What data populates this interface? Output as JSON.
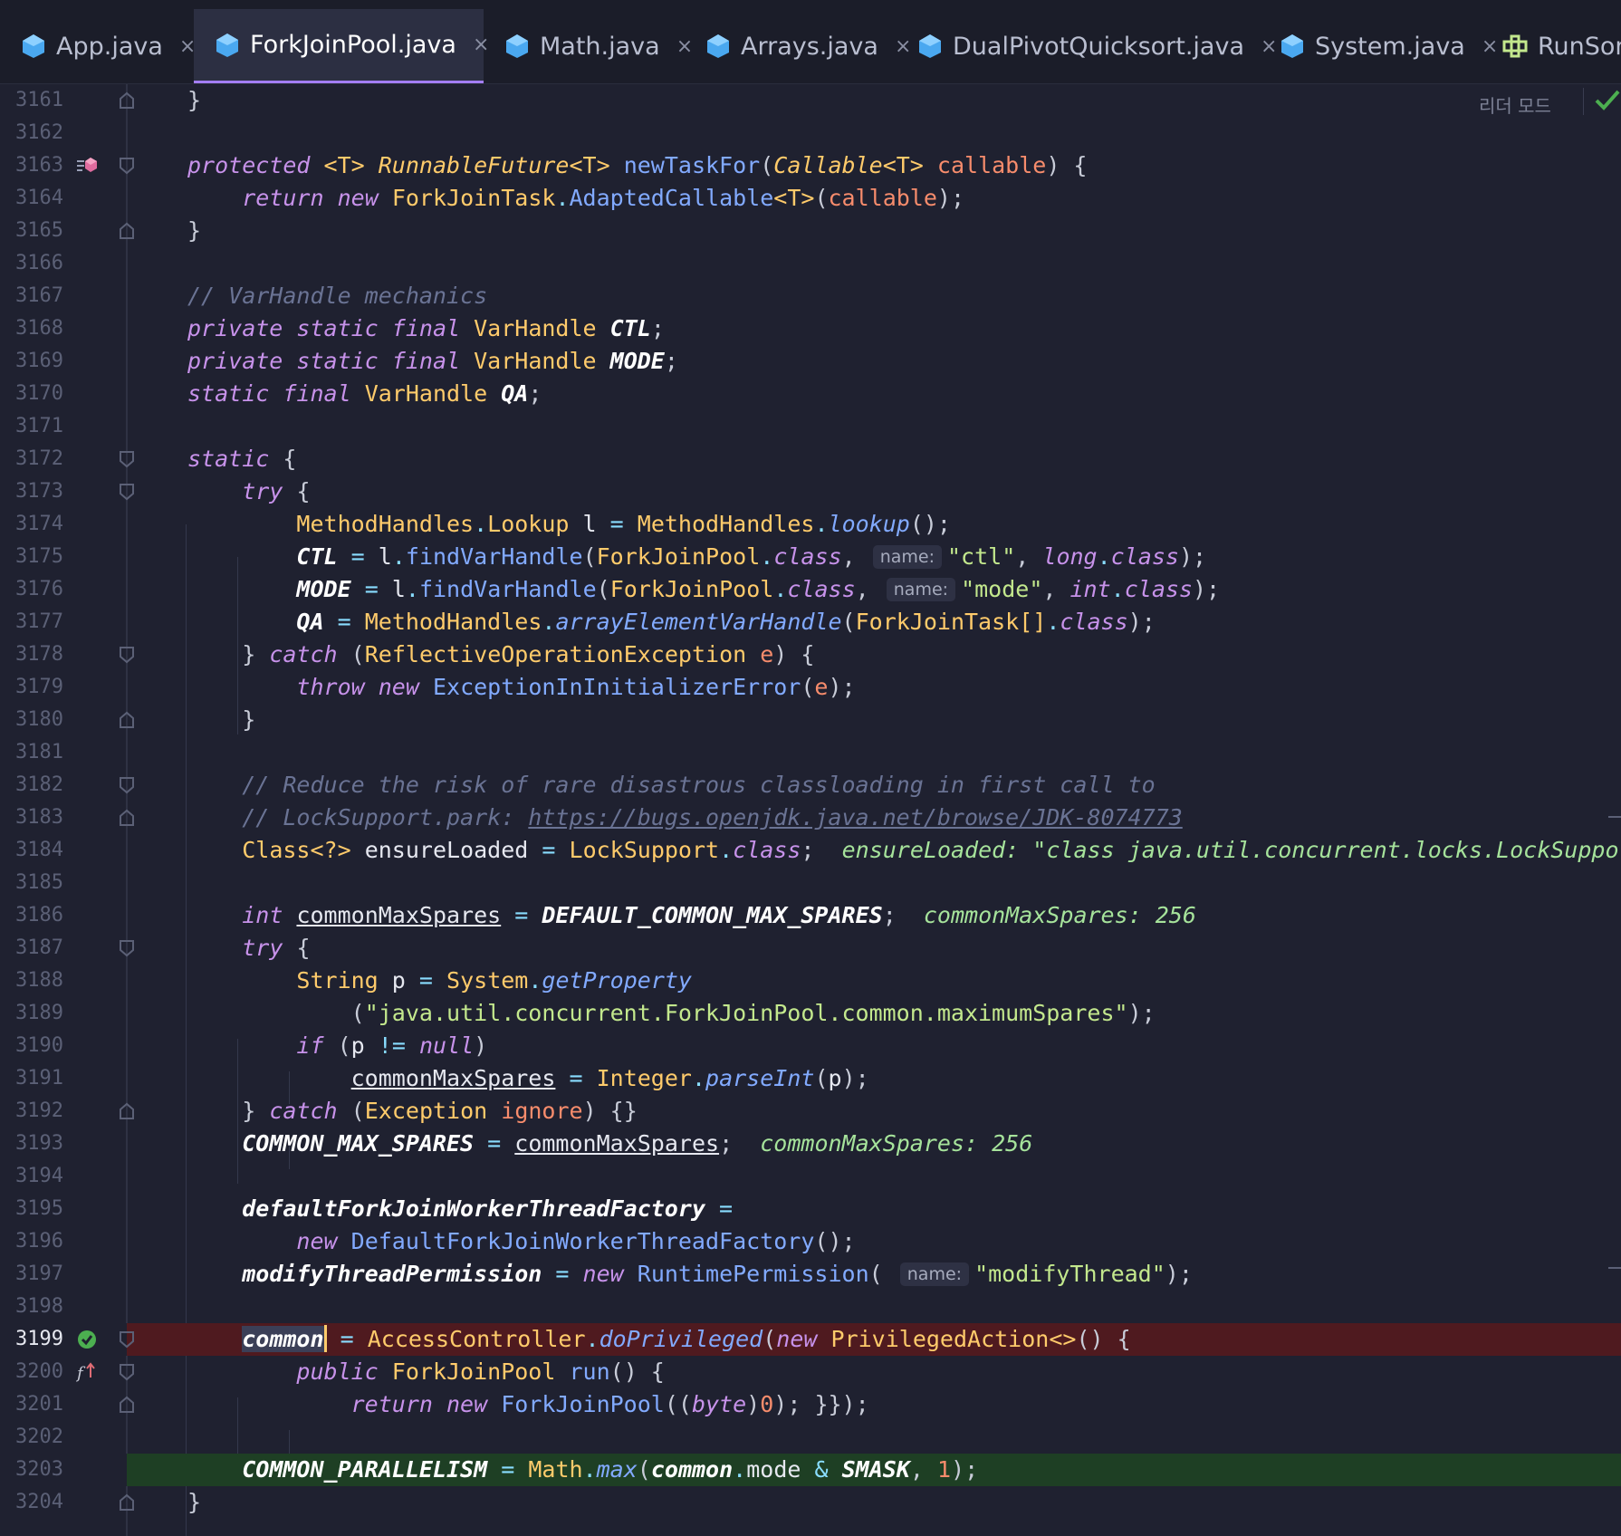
{
  "tabs": [
    {
      "label": "App.java",
      "active": false
    },
    {
      "label": "ForkJoinPool.java",
      "active": true
    },
    {
      "label": "Math.java",
      "active": false
    },
    {
      "label": "Arrays.java",
      "active": false
    },
    {
      "label": "DualPivotQuicksort.java",
      "active": false
    },
    {
      "label": "System.java",
      "active": false
    },
    {
      "label": "RunSon",
      "active": false
    }
  ],
  "tab_close_glyph": "×",
  "reader_mode_label": "리더 모드",
  "colors": {
    "accent": "#a37ef5",
    "breakpoint_line": "#4f1a1f",
    "execution_line": "#1e3f24"
  },
  "hints": {
    "name": "name:"
  },
  "lines": {
    "n3161": "3161",
    "n3162": "3162",
    "n3163": "3163",
    "n3164": "3164",
    "n3165": "3165",
    "n3166": "3166",
    "n3167": "3167",
    "n3168": "3168",
    "n3169": "3169",
    "n3170": "3170",
    "n3171": "3171",
    "n3172": "3172",
    "n3173": "3173",
    "n3174": "3174",
    "n3175": "3175",
    "n3176": "3176",
    "n3177": "3177",
    "n3178": "3178",
    "n3179": "3179",
    "n3180": "3180",
    "n3181": "3181",
    "n3182": "3182",
    "n3183": "3183",
    "n3184": "3184",
    "n3185": "3185",
    "n3186": "3186",
    "n3187": "3187",
    "n3188": "3188",
    "n3189": "3189",
    "n3190": "3190",
    "n3191": "3191",
    "n3192": "3192",
    "n3193": "3193",
    "n3194": "3194",
    "n3195": "3195",
    "n3196": "3196",
    "n3197": "3197",
    "n3198": "3198",
    "n3199": "3199",
    "n3200": "3200",
    "n3201": "3201",
    "n3202": "3202",
    "n3203": "3203",
    "n3204": "3204"
  },
  "code": {
    "t_close_brace": "}",
    "t_protected": "protected",
    "t_T_generic": "<T>",
    "t_RunnableFuture": "RunnableFuture",
    "t_newTaskFor": "newTaskFor",
    "t_Callable": "Callable",
    "t_callable": "callable",
    "t_return": "return",
    "t_new": "new",
    "t_ForkJoinTask": "ForkJoinTask",
    "t_AdaptedCallable": "AdaptedCallable",
    "t_comment_varhandle": "// VarHandle mechanics",
    "t_private": "private",
    "t_static": "static",
    "t_final": "final",
    "t_VarHandle": "VarHandle",
    "t_CTL": "CTL",
    "t_MODE": "MODE",
    "t_QA": "QA",
    "t_try": "try",
    "t_MethodHandles": "MethodHandles",
    "t_Lookup": "Lookup",
    "t_l": "l",
    "t_lookup": "lookup",
    "t_findVarHandle": "findVarHandle",
    "t_ForkJoinPool": "ForkJoinPool",
    "t_class": "class",
    "t_str_ctl": "\"ctl\"",
    "t_long": "long",
    "t_str_mode": "\"mode\"",
    "t_int": "int",
    "t_arrayElementVarHandle": "arrayElementVarHandle",
    "t_ForkJoinTask_arr": "ForkJoinTask[]",
    "t_catch": "catch",
    "t_ReflectiveOperationException": "ReflectiveOperationException",
    "t_e": "e",
    "t_throw": "throw",
    "t_ExceptionInInitializerError": "ExceptionInInitializerError",
    "t_comment_reduce": "// Reduce the risk of rare disastrous classloading in first call to",
    "t_comment_locksupport": "// LockSupport.park: ",
    "t_link": "https://bugs.openjdk.java.net/browse/JDK-8074773",
    "t_Class_wild": "Class<?>",
    "t_ensureLoaded": "ensureLoaded",
    "t_LockSupport": "LockSupport",
    "t_inline_ensureLoaded": "ensureLoaded: \"class java.util.concurrent.locks.LockSupport\"",
    "t_commonMaxSpares": "commonMaxSpares",
    "t_DEFAULT_COMMON_MAX_SPARES": "DEFAULT_COMMON_MAX_SPARES",
    "t_inline_spares": "commonMaxSpares: 256",
    "t_String": "String",
    "t_p": "p",
    "t_System": "System",
    "t_getProperty": "getProperty",
    "t_str_prop": "\"java.util.concurrent.ForkJoinPool.common.maximumSpares\"",
    "t_if": "if",
    "t_null": "null",
    "t_Integer": "Integer",
    "t_parseInt": "parseInt",
    "t_Exception": "Exception",
    "t_ignore": "ignore",
    "t_COMMON_MAX_SPARES": "COMMON_MAX_SPARES",
    "t_defaultFactory": "defaultForkJoinWorkerThreadFactory",
    "t_DefaultFactory": "DefaultForkJoinWorkerThreadFactory",
    "t_modifyThreadPermission": "modifyThreadPermission",
    "t_RuntimePermission": "RuntimePermission",
    "t_str_modifyThread": "\"modifyThread\"",
    "t_common": "common",
    "t_AccessController": "AccessController",
    "t_doPrivileged": "doPrivileged",
    "t_PrivilegedAction": "PrivilegedAction<>",
    "t_public": "public",
    "t_run": "run",
    "t_byte": "byte",
    "t_zero": "0",
    "t_one": "1",
    "t_COMMON_PARALLELISM": "COMMON_PARALLELISM",
    "t_Math": "Math",
    "t_max": "max",
    "t_mode": "mode",
    "t_SMASK": "SMASK"
  }
}
